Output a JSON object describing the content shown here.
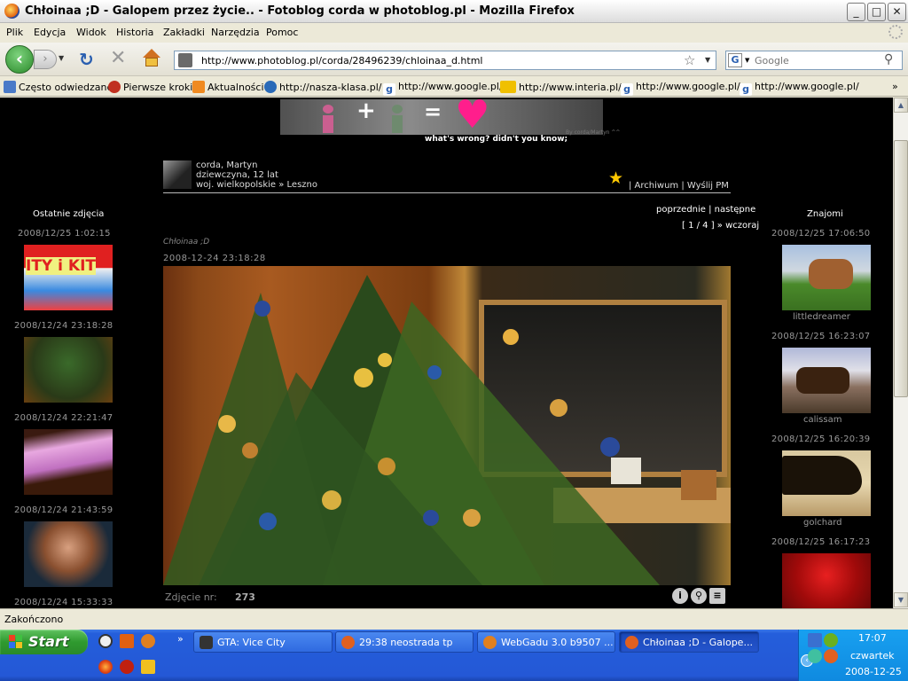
{
  "window": {
    "title": "Chłoinaa ;D - Galopem przez życie.. - Fotoblog corda w photoblog.pl - Mozilla Firefox",
    "min": "_",
    "max": "□",
    "close": "✕"
  },
  "menu": [
    "Plik",
    "Edycja",
    "Widok",
    "Historia",
    "Zakładki",
    "Narzędzia",
    "Pomoc"
  ],
  "nav": {
    "url": "http://www.photoblog.pl/corda/28496239/chloinaa_d.html",
    "search_placeholder": "Google",
    "search_engine": "G"
  },
  "bookmarks": [
    {
      "label": "Często odwiedzane",
      "icon": "folder-icon",
      "color": "#4a7ac8"
    },
    {
      "label": "Pierwsze kroki",
      "icon": "firefox-icon",
      "color": "#c03020"
    },
    {
      "label": "Aktualności",
      "icon": "rss-icon",
      "color": "#f08a20"
    },
    {
      "label": "http://nasza-klasa.pl/",
      "icon": "nk-icon",
      "color": "#2a6ab8"
    },
    {
      "label": "http://www.google.pl/",
      "icon": "google-icon",
      "color": "#ffffff"
    },
    {
      "label": "http://www.interia.pl/",
      "icon": "interia-icon",
      "color": "#f0c000"
    },
    {
      "label": "http://www.google.pl/",
      "icon": "google-icon",
      "color": "#ffffff"
    },
    {
      "label": "http://www.google.pl/",
      "icon": "google-icon",
      "color": "#ffffff"
    }
  ],
  "banner": {
    "tagline": "what's wrong? didn't you know;",
    "signature": "By corda/Martyn ^^"
  },
  "profile": {
    "name": "corda, Martyn",
    "info": "dziewczyna, 12 lat",
    "location": "woj. wielkopolskie » Leszno",
    "links": "| Archiwum | Wyślij PM"
  },
  "photo": {
    "nav": "poprzednie | następne",
    "pager": "[ 1 / 4 ] » wczoraj",
    "title": "Chłoinaa ;D",
    "date": "2008-12-24 23:18:28",
    "number_label": "Zdjęcie nr:",
    "number_value": "273"
  },
  "left_col": {
    "heading": "Ostatnie zdjęcia",
    "items": [
      {
        "date": "2008/12/25 1:02:15"
      },
      {
        "date": "2008/12/24 23:18:28"
      },
      {
        "date": "2008/12/24 22:21:47"
      },
      {
        "date": "2008/12/24 21:43:59"
      },
      {
        "date": "2008/12/24 15:33:33"
      }
    ],
    "thumb1_text": "ITY i KIT"
  },
  "right_col": {
    "heading": "Znajomi",
    "items": [
      {
        "date": "2008/12/25 17:06:50",
        "name": "littledreamer"
      },
      {
        "date": "2008/12/25 16:23:07",
        "name": "calissam"
      },
      {
        "date": "2008/12/25 16:20:39",
        "name": "golchard"
      },
      {
        "date": "2008/12/25 16:17:23",
        "name": ""
      }
    ]
  },
  "status": "Zakończono",
  "taskbar": {
    "start": "Start",
    "tasks": [
      {
        "label": "GTA: Vice City",
        "color": "#333333"
      },
      {
        "label": "29:38 neostrada tp",
        "color": "#e06020"
      },
      {
        "label": "WebGadu 3.0 b9507 ...",
        "color": "#e08020"
      },
      {
        "label": "Chłoinaa ;D - Galope...",
        "color": "#e06020"
      }
    ],
    "time": "17:07",
    "day": "czwartek",
    "date": "2008-12-25"
  }
}
